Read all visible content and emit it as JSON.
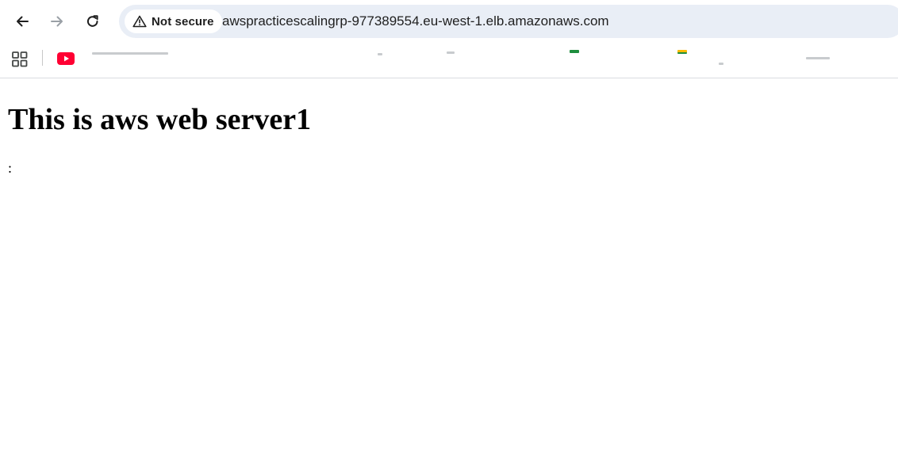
{
  "browser": {
    "security_label": "Not secure",
    "url": "awspracticescalingrp-977389554.eu-west-1.elb.amazonaws.com"
  },
  "icons": {
    "back": "arrow-back-icon",
    "forward": "arrow-forward-icon",
    "reload": "reload-icon",
    "warning": "warning-triangle-icon",
    "apps": "apps-grid-icon",
    "youtube": "youtube-icon"
  },
  "colors": {
    "omnibox_bg": "#e9eef6",
    "youtube_red": "#ff0033",
    "forward_disabled": "#9aa0a6"
  },
  "page": {
    "heading": "This is aws web server1",
    "paragraph": ":"
  }
}
